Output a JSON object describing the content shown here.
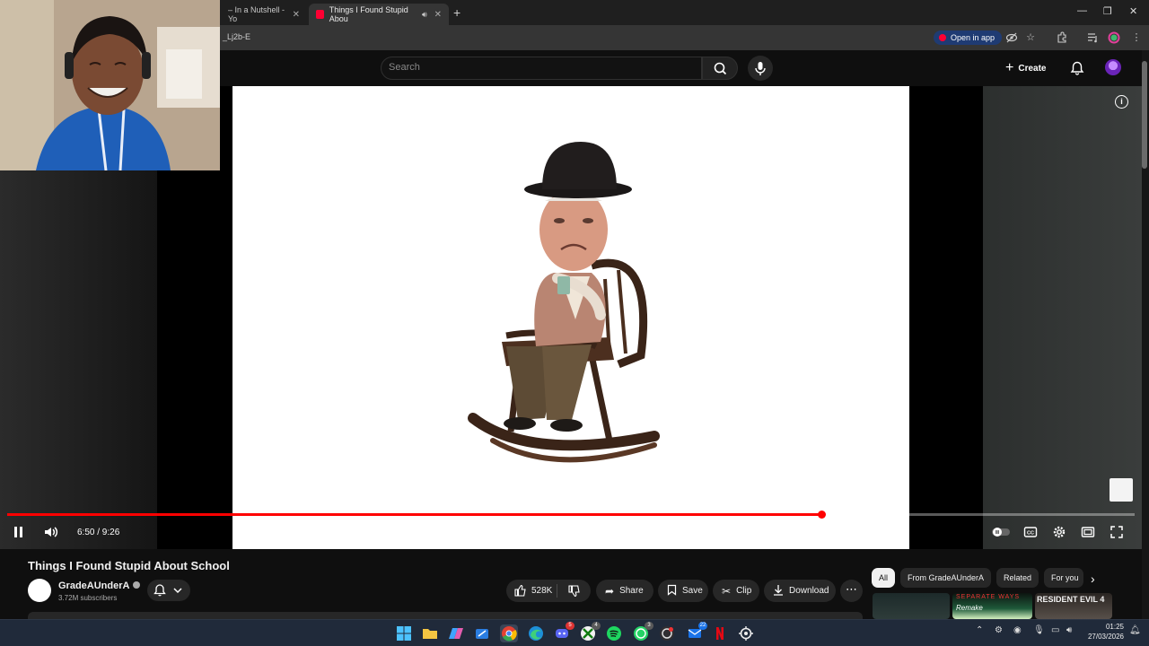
{
  "browser": {
    "tabs": [
      {
        "title": "– In a Nutshell - Yo"
      },
      {
        "title": "Things I Found Stupid Abou"
      }
    ],
    "url_fragment": "_Lj2b-E",
    "open_in_app_label": "Open in app"
  },
  "masthead": {
    "search_placeholder": "Search",
    "create_label": "Create"
  },
  "player": {
    "time_display": "6:50 / 9:26",
    "progress": 0.7222
  },
  "video": {
    "title": "Things I Found Stupid About School",
    "channel": {
      "name": "GradeAUnderA",
      "subscribers": "3.72M subscribers"
    },
    "actions": {
      "likes": "528K",
      "share": "Share",
      "save": "Save",
      "clip": "Clip",
      "download": "Download"
    }
  },
  "sidebar": {
    "chips": [
      "All",
      "From GradeAUnderA",
      "Related",
      "For you"
    ],
    "thumb_texts": [
      "SEPARATE WAYS",
      "Remake",
      "RESIDENT EVIL 4"
    ]
  },
  "taskbar": {
    "time": "01:25",
    "date": "27/03/2026",
    "badges": [
      "5",
      "4",
      "3",
      "22"
    ]
  },
  "colors": {
    "progress": "#ff0000",
    "youtube_red": "#ff0033",
    "background": "#0f0f0f"
  }
}
